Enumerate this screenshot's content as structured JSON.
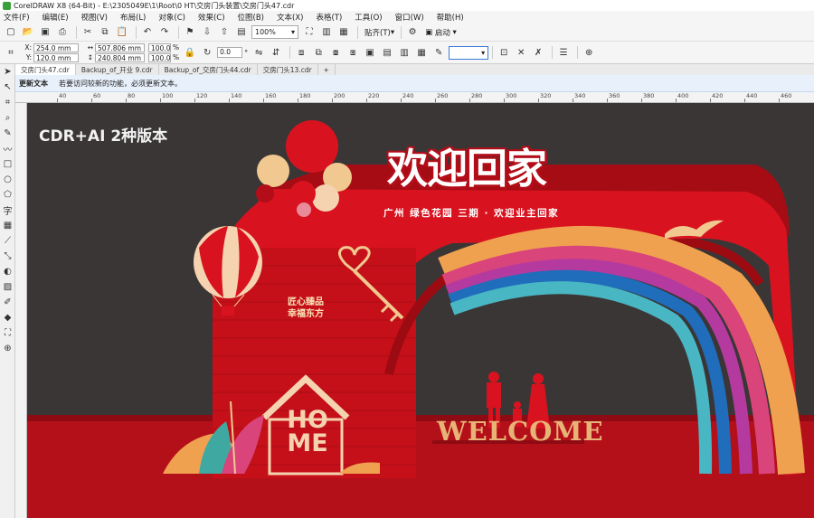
{
  "window": {
    "title": "CorelDRAW X8 (64-Bit) - E:\\2305049E\\1\\Root\\0 HT\\交房门头装置\\交房门头47.cdr"
  },
  "menu": [
    "文件(F)",
    "编辑(E)",
    "视图(V)",
    "布局(L)",
    "对象(C)",
    "效果(C)",
    "位图(B)",
    "文本(X)",
    "表格(T)",
    "工具(O)",
    "窗口(W)",
    "帮助(H)"
  ],
  "toolbar": {
    "zoom_value": "100%",
    "snap_label": "贴齐(T)",
    "launch_label": "启动"
  },
  "property_bar": {
    "x_label": "X:",
    "x_value": "254.0 mm",
    "y_label": "Y:",
    "y_value": "120.0 mm",
    "width_value": "507.806 mm",
    "height_value": "240.804 mm",
    "scale_x": "100.0",
    "scale_y": "100.0",
    "percent_symbol": "%",
    "rotation_value": "0.0",
    "rotation_unit": "°",
    "outline_value": ""
  },
  "doc_tabs": [
    {
      "label": "交房门头47.cdr",
      "active": true
    },
    {
      "label": "Backup_of_开业 9.cdr",
      "active": false
    },
    {
      "label": "Backup_of_交房门头44.cdr",
      "active": false
    },
    {
      "label": "交房门头13.cdr",
      "active": false
    }
  ],
  "hint_bar": {
    "title": "更新文本",
    "message": "若要访问较新的功能，必须更新文本。"
  },
  "ruler": {
    "h_labels": [
      "40",
      "60",
      "80",
      "100",
      "120",
      "140",
      "160",
      "180",
      "200",
      "220",
      "240",
      "260",
      "280",
      "300",
      "320",
      "340",
      "360",
      "380",
      "400",
      "420",
      "440",
      "460"
    ]
  },
  "artwork": {
    "version_label": "CDR+AI 2种版本",
    "title": "欢迎回家",
    "subtitle": "广州 绿色花园 三期 · 欢迎业主回家",
    "slogan_line1": "匠心臻品",
    "slogan_line2": "幸福东方",
    "welcome": "WELCOME",
    "home_letters": "HOME",
    "colors": {
      "background": "#3b3636",
      "red": "#d8131f",
      "dark_red": "#a50c14",
      "gold": "#f0c890",
      "rainbow": [
        "#f0a150",
        "#d9447a",
        "#b53aa0",
        "#1f6dbb",
        "#49b6c4"
      ]
    }
  }
}
